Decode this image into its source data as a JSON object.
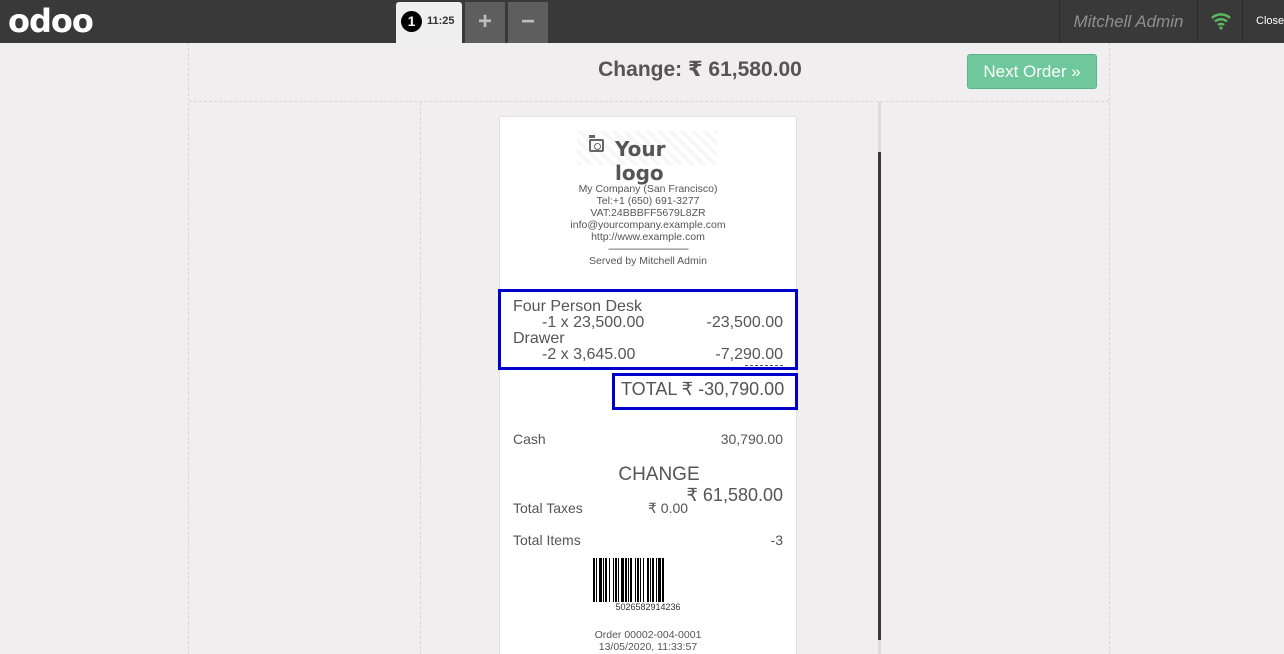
{
  "topbar": {
    "logo": "odoo",
    "order_number": "1",
    "order_time": "11:25",
    "add_icon": "plus-icon",
    "add_symbol": "+",
    "remove_icon": "minus-icon",
    "remove_symbol": "−",
    "user": "Mitchell Admin",
    "wifi_icon": "wifi-icon",
    "close_label": "Close"
  },
  "header": {
    "change_title": "Change: ₹ 61,580.00",
    "next_button": "Next Order »"
  },
  "receipt": {
    "logo_icon": "camera-icon",
    "logo_text": "Your logo",
    "company": {
      "name": "My Company (San Francisco)",
      "tel": "Tel:+1 (650) 691-3277",
      "vat": "VAT:24BBBFF5679L8ZR",
      "email": "info@yourcompany.example.com",
      "website": "http://www.example.com",
      "separator": "--------------------------------",
      "served_by": "Served by Mitchell Admin"
    },
    "lines": [
      {
        "product": "Four Person Desk",
        "qty_price": "-1 x 23,500.00",
        "amount": "-23,500.00"
      },
      {
        "product": "Drawer",
        "qty_price": "-2 x 3,645.00",
        "amount": "-7,290.00"
      }
    ],
    "total": "TOTAL  ₹ -30,790.00",
    "payment_method": "Cash",
    "payment_amount": "30,790.00",
    "change_label": "CHANGE",
    "change_value": "₹ 61,580.00",
    "taxes_label": "Total Taxes",
    "taxes_value": "₹ 0.00",
    "items_label": "Total Items",
    "items_value": "-3",
    "barcode_number": "5026582914236",
    "order_ref": "Order 00002-004-0001",
    "order_date": "13/05/2020, 11:33:57"
  },
  "colors": {
    "topbar": "#393939",
    "accent_green": "#6ec89b",
    "highlight_box": "#0000cc",
    "wifi": "#5cb85c"
  }
}
